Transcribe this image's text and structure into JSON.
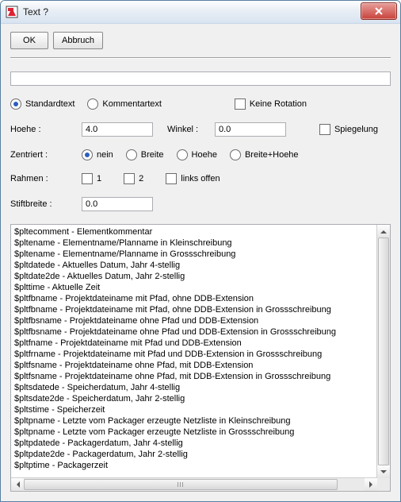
{
  "window": {
    "title": "Text ?"
  },
  "buttons": {
    "ok": "OK",
    "cancel": "Abbruch"
  },
  "mainInput": {
    "value": ""
  },
  "typeRow": {
    "standard": "Standardtext",
    "comment": "Kommentartext",
    "noRotation": "Keine Rotation"
  },
  "dims": {
    "heightLabel": "Hoehe :",
    "heightValue": "4.0",
    "angleLabel": "Winkel :",
    "angleValue": "0.0",
    "mirror": "Spiegelung"
  },
  "center": {
    "label": "Zentriert :",
    "none": "nein",
    "width": "Breite",
    "height": "Hoehe",
    "both": "Breite+Hoehe"
  },
  "frame": {
    "label": "Rahmen :",
    "one": "1",
    "two": "2",
    "openLeft": "links offen"
  },
  "pen": {
    "label": "Stiftbreite :",
    "value": "0.0"
  },
  "variables": [
    "$pltecomment - Elementkommentar",
    "$pltename - Elementname/Planname in Kleinschreibung",
    "$pltename - Elementname/Planname in Grossschreibung",
    "$pltdatede - Aktuelles Datum, Jahr 4-stellig",
    "$pltdate2de - Aktuelles Datum, Jahr 2-stellig",
    "$plttime - Aktuelle Zeit",
    "$pltfbname - Projektdateiname mit Pfad, ohne DDB-Extension",
    "$pltfbname - Projektdateiname mit Pfad, ohne DDB-Extension in Grossschreibung",
    "$pltfbsname - Projektdateiname ohne Pfad und DDB-Extension",
    "$pltfbsname - Projektdateiname ohne Pfad und DDB-Extension in Grossschreibung",
    "$pltfname - Projektdateiname mit Pfad und DDB-Extension",
    "$pltfrname - Projektdateiname mit Pfad und DDB-Extension in Grossschreibung",
    "$pltfsname - Projektdateiname ohne Pfad, mit DDB-Extension",
    "$pltfsname - Projektdateiname ohne Pfad, mit DDB-Extension in Grossschreibung",
    "$pltsdatede - Speicherdatum, Jahr 4-stellig",
    "$pltsdate2de - Speicherdatum, Jahr 2-stellig",
    "$pltstime - Speicherzeit",
    "$pltpname - Letzte vom Packager erzeugte Netzliste in Kleinschreibung",
    "$pltpname - Letzte vom Packager erzeugte Netzliste in Grossschreibung",
    "$pltpdatede - Packagerdatum, Jahr 4-stellig",
    "$pltpdate2de - Packagerdatum, Jahr 2-stellig",
    "$pltptime - Packagerzeit"
  ]
}
